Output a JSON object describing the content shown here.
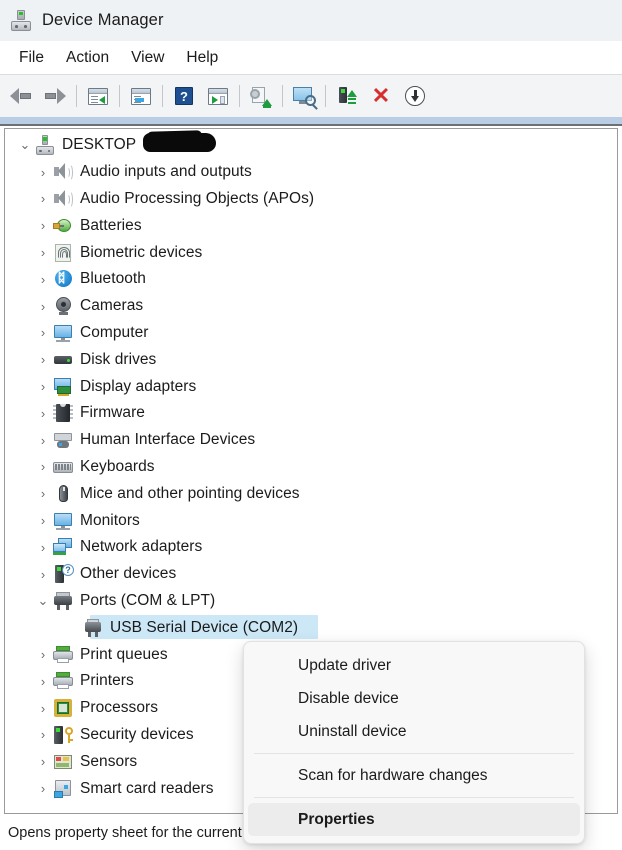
{
  "window": {
    "title": "Device Manager",
    "icon": "device-manager-icon"
  },
  "menubar": {
    "items": [
      {
        "label": "File"
      },
      {
        "label": "Action"
      },
      {
        "label": "View"
      },
      {
        "label": "Help"
      }
    ]
  },
  "toolbar": {
    "buttons": [
      {
        "icon": "back-arrow-icon",
        "name": "back-button"
      },
      {
        "icon": "forward-arrow-icon",
        "name": "forward-button"
      },
      {
        "icon": "show-hide-console-tree-icon",
        "name": "show-hide-console-tree-button"
      },
      {
        "icon": "properties-window-icon",
        "name": "properties-button"
      },
      {
        "icon": "help-question-icon",
        "name": "help-button"
      },
      {
        "icon": "action-menu-icon",
        "name": "action-menu-button"
      },
      {
        "icon": "update-driver-icon",
        "name": "update-driver-button"
      },
      {
        "icon": "scan-hardware-changes-icon",
        "name": "scan-for-hardware-changes-button"
      },
      {
        "icon": "enable-device-icon",
        "name": "enable-device-button"
      },
      {
        "icon": "uninstall-device-icon",
        "name": "uninstall-device-button"
      },
      {
        "icon": "disable-device-icon",
        "name": "disable-device-button"
      }
    ]
  },
  "tree": {
    "root": {
      "label": "DESKTOP",
      "icon": "computer-icon",
      "expanded": true,
      "redacted": true
    },
    "items": [
      {
        "label": "Audio inputs and outputs",
        "icon": "speaker-icon",
        "expanded": false,
        "level": 1
      },
      {
        "label": "Audio Processing Objects (APOs)",
        "icon": "speaker-icon",
        "expanded": false,
        "level": 1
      },
      {
        "label": "Batteries",
        "icon": "battery-icon",
        "expanded": false,
        "level": 1
      },
      {
        "label": "Biometric devices",
        "icon": "fingerprint-icon",
        "expanded": false,
        "level": 1
      },
      {
        "label": "Bluetooth",
        "icon": "bluetooth-icon",
        "expanded": false,
        "level": 1
      },
      {
        "label": "Cameras",
        "icon": "camera-icon",
        "expanded": false,
        "level": 1
      },
      {
        "label": "Computer",
        "icon": "monitor-icon",
        "expanded": false,
        "level": 1
      },
      {
        "label": "Disk drives",
        "icon": "disk-drive-icon",
        "expanded": false,
        "level": 1
      },
      {
        "label": "Display adapters",
        "icon": "display-adapter-icon",
        "expanded": false,
        "level": 1
      },
      {
        "label": "Firmware",
        "icon": "firmware-chip-icon",
        "expanded": false,
        "level": 1
      },
      {
        "label": "Human Interface Devices",
        "icon": "hid-icon",
        "expanded": false,
        "level": 1
      },
      {
        "label": "Keyboards",
        "icon": "keyboard-icon",
        "expanded": false,
        "level": 1
      },
      {
        "label": "Mice and other pointing devices",
        "icon": "mouse-icon",
        "expanded": false,
        "level": 1
      },
      {
        "label": "Monitors",
        "icon": "monitor-icon",
        "expanded": false,
        "level": 1
      },
      {
        "label": "Network adapters",
        "icon": "network-adapter-icon",
        "expanded": false,
        "level": 1
      },
      {
        "label": "Other devices",
        "icon": "other-device-icon",
        "expanded": false,
        "level": 1
      },
      {
        "label": "Ports (COM & LPT)",
        "icon": "port-icon",
        "expanded": true,
        "level": 1
      },
      {
        "label": "USB Serial Device (COM2)",
        "icon": "usb-serial-device-icon",
        "selected": true,
        "level": 2
      },
      {
        "label": "Print queues",
        "icon": "printer-icon",
        "expanded": false,
        "level": 1
      },
      {
        "label": "Printers",
        "icon": "printer-icon",
        "expanded": false,
        "level": 1
      },
      {
        "label": "Processors",
        "icon": "processor-icon",
        "expanded": false,
        "level": 1
      },
      {
        "label": "Security devices",
        "icon": "security-device-icon",
        "expanded": false,
        "level": 1
      },
      {
        "label": "Sensors",
        "icon": "sensor-icon",
        "expanded": false,
        "level": 1
      },
      {
        "label": "Smart card readers",
        "icon": "smart-card-reader-icon",
        "expanded": false,
        "level": 1
      }
    ],
    "chevron_expanded": "⌄",
    "chevron_collapsed": "›"
  },
  "context_menu": {
    "items": [
      {
        "label": "Update driver",
        "type": "item"
      },
      {
        "label": "Disable device",
        "type": "item"
      },
      {
        "label": "Uninstall device",
        "type": "item"
      },
      {
        "type": "separator"
      },
      {
        "label": "Scan for hardware changes",
        "type": "item"
      },
      {
        "type": "separator"
      },
      {
        "label": "Properties",
        "type": "item",
        "bold": true,
        "highlighted": true
      }
    ]
  },
  "statusbar": {
    "text": "Opens property sheet for the current selection."
  },
  "colors": {
    "titlebar_bg": "#eef2f5",
    "toolbar_bg": "#f3f4f6",
    "selection_bg": "#cce8f7",
    "band": "#b9cde4",
    "menu_bg": "#f8f8f8",
    "menu_highlight": "#ececec",
    "text": "#1b1b1b"
  }
}
